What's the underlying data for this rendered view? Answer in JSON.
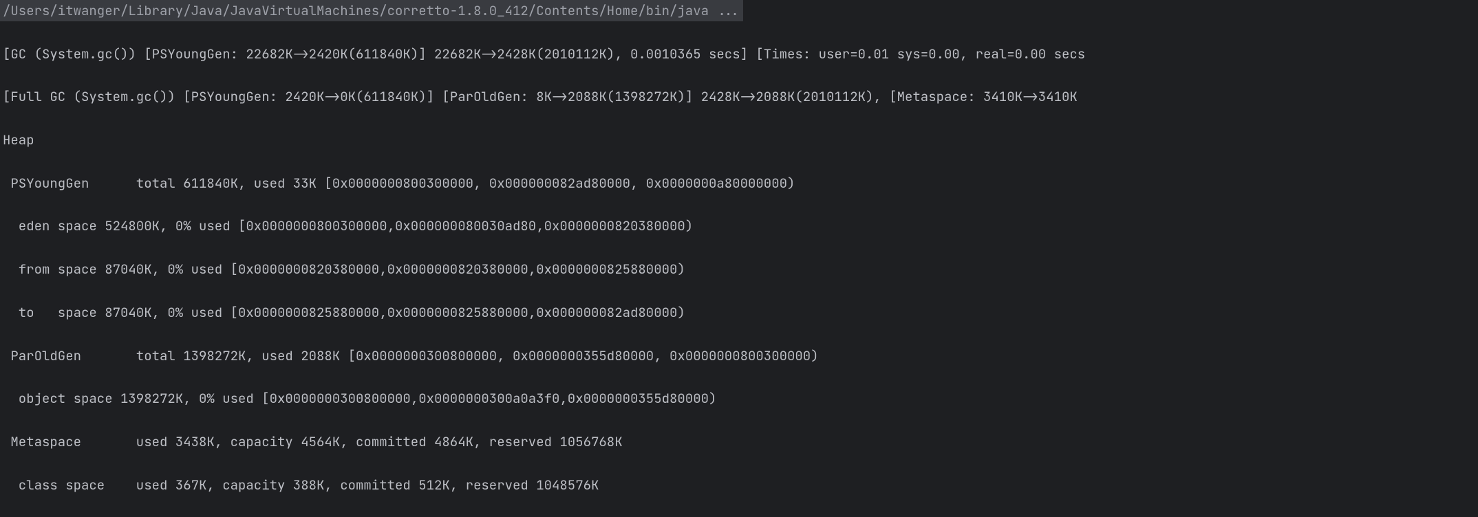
{
  "command_line": "/Users/itwanger/Library/Java/JavaVirtualMachines/corretto-1.8.0_412/Contents/Home/bin/java ...",
  "output": {
    "gc_line": "[GC (System.gc()) [PSYoungGen: 22682K->2420K(611840K)] 22682K->2428K(2010112K), 0.0010365 secs] [Times: user=0.01 sys=0.00, real=0.00 secs",
    "full_gc_line": "[Full GC (System.gc()) [PSYoungGen: 2420K->0K(611840K)] [ParOldGen: 8K->2088K(1398272K)] 2428K->2088K(2010112K), [Metaspace: 3410K->3410K",
    "heap_header": "Heap",
    "ps_young_gen": " PSYoungGen      total 611840K, used 33K [0x0000000800300000, 0x000000082ad80000, 0x0000000a80000000)",
    "eden_space": "  eden space 524800K, 0% used [0x0000000800300000,0x000000080030ad80,0x0000000820380000)",
    "from_space": "  from space 87040K, 0% used [0x0000000820380000,0x0000000820380000,0x0000000825880000)",
    "to_space": "  to   space 87040K, 0% used [0x0000000825880000,0x0000000825880000,0x000000082ad80000)",
    "par_old_gen": " ParOldGen       total 1398272K, used 2088K [0x0000000300800000, 0x0000000355d80000, 0x0000000800300000)",
    "object_space": "  object space 1398272K, 0% used [0x0000000300800000,0x0000000300a0a3f0,0x0000000355d80000)",
    "metaspace": " Metaspace       used 3438K, capacity 4564K, committed 4864K, reserved 1056768K",
    "class_space": "  class space    used 367K, capacity 388K, committed 512K, reserved 1048576K"
  }
}
